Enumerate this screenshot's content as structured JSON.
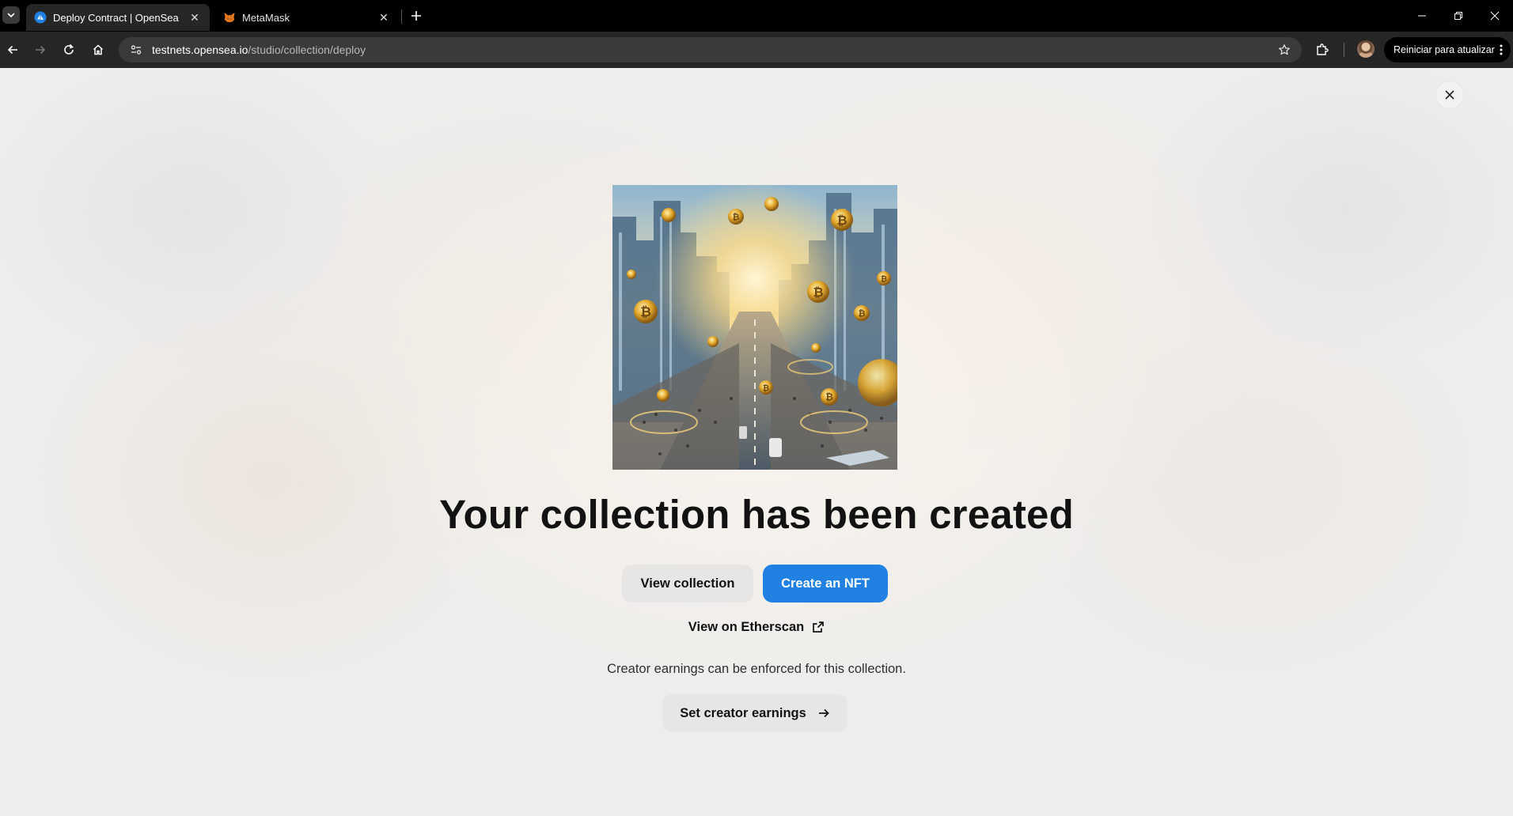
{
  "browser": {
    "tabs": [
      {
        "title": "Deploy Contract | OpenSea",
        "active": true,
        "favicon": "opensea-icon"
      },
      {
        "title": "MetaMask",
        "active": false,
        "favicon": "metamask-fox-icon"
      }
    ],
    "url": {
      "host": "testnets.opensea.io",
      "path": "/studio/collection/deploy"
    },
    "update_label": "Reiniciar para atualizar"
  },
  "page": {
    "image_alt": "Collection artwork: futuristic city with floating bitcoin coins",
    "headline": "Your collection has been created",
    "view_collection_label": "View collection",
    "create_nft_label": "Create an NFT",
    "etherscan_label": "View on Etherscan",
    "earnings_note": "Creator earnings can be enforced for this collection.",
    "set_earnings_label": "Set creator earnings"
  },
  "colors": {
    "primary_button": "#2081e2",
    "secondary_button": "#e7e6e4",
    "text": "#121212"
  }
}
